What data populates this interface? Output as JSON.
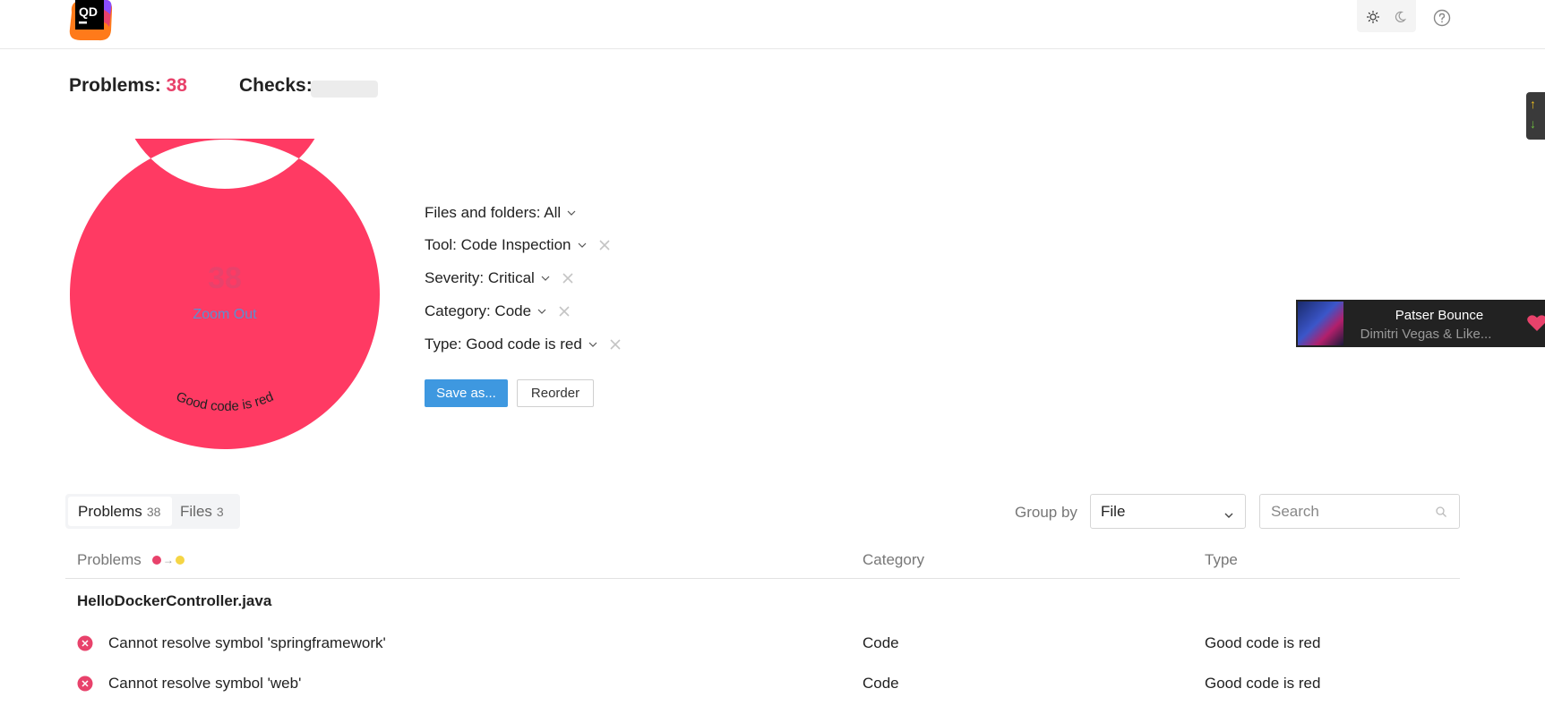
{
  "header": {
    "logo_text": "QD",
    "theme_light_icon": "sun-icon",
    "theme_dark_icon": "moon-icon",
    "help_icon": "question-circle-icon"
  },
  "summary": {
    "problems_label": "Problems:",
    "problems_count": "38",
    "checks_label": "Checks:"
  },
  "chart_data": {
    "type": "pie",
    "center_value": "38",
    "center_link": "Zoom Out",
    "slices": [
      {
        "label": "Good code is red",
        "value": 38,
        "color": "#ff3a63"
      }
    ]
  },
  "filters": [
    {
      "label": "Files and folders: All",
      "clearable": false
    },
    {
      "label": "Tool: Code Inspection",
      "clearable": true
    },
    {
      "label": "Severity: Critical",
      "clearable": true
    },
    {
      "label": "Category: Code",
      "clearable": true
    },
    {
      "label": "Type: Good code is red",
      "clearable": true
    }
  ],
  "actions": {
    "save_label": "Save as...",
    "reorder_label": "Reorder"
  },
  "tabs": [
    {
      "label": "Problems",
      "count": "38",
      "active": true
    },
    {
      "label": "Files",
      "count": "3",
      "active": false
    }
  ],
  "group_by": {
    "label": "Group by",
    "selected": "File"
  },
  "search": {
    "placeholder": "Search"
  },
  "table": {
    "columns": [
      "Problems",
      "Category",
      "Type"
    ],
    "severity_colors": [
      "#e8426b",
      "#f5d545"
    ],
    "group": "HelloDockerController.java",
    "rows": [
      {
        "message": "Cannot resolve symbol 'springframework'",
        "category": "Code",
        "type": "Good code is red"
      },
      {
        "message": "Cannot resolve symbol 'web'",
        "category": "Code",
        "type": "Good code is red"
      }
    ]
  },
  "media": {
    "title": "Patser Bounce",
    "artist": "Dimitri Vegas & Like..."
  },
  "colors": {
    "accent": "#e8426b",
    "primary_button": "#3e98e0",
    "link": "#5b8fd0"
  }
}
